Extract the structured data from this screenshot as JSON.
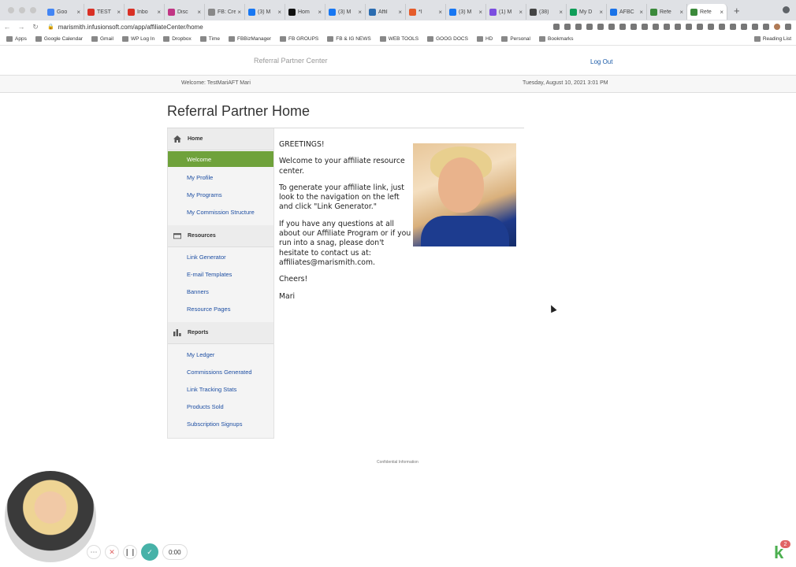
{
  "browser": {
    "tabs": [
      {
        "label": "Goo",
        "color": "#4285f4"
      },
      {
        "label": "TEST",
        "color": "#d93025"
      },
      {
        "label": "Inbo",
        "color": "#d93025"
      },
      {
        "label": "Disc",
        "color": "#c13584"
      },
      {
        "label": "FB: Crea",
        "color": "#888888"
      },
      {
        "label": "(3) M",
        "color": "#1877f2"
      },
      {
        "label": "Hom",
        "color": "#111111"
      },
      {
        "label": "(3) M",
        "color": "#1877f2"
      },
      {
        "label": "Affil",
        "color": "#2b6cb0"
      },
      {
        "label": "*I",
        "color": "#e55c2b"
      },
      {
        "label": "(3) M",
        "color": "#1877f2"
      },
      {
        "label": "(1) M",
        "color": "#7b4de0"
      },
      {
        "label": "(38)",
        "color": "#444444"
      },
      {
        "label": "My D",
        "color": "#0f9d58"
      },
      {
        "label": "AFBC",
        "color": "#1a73e8"
      },
      {
        "label": "Refe",
        "color": "#3b8a3b"
      },
      {
        "label": "Refe",
        "color": "#3b8a3b",
        "active": true
      }
    ],
    "url": "marismith.infusionsoft.com/app/affiliateCenter/home",
    "bookmarks": [
      "Apps",
      "Google Calendar",
      "Gmail",
      "WP Log In",
      "Dropbox",
      "Time",
      "FBBizManager",
      "FB GROUPS",
      "FB & IG NEWS",
      "WEB TOOLS",
      "GOOG DOCS",
      "HD",
      "Personal",
      "Bookmarks"
    ],
    "reading_list": "Reading List"
  },
  "header": {
    "title": "Referral Partner Center",
    "logout": "Log Out",
    "welcome": "Welcome: TestMariAFT Mari",
    "datetime": "Tuesday, August 10, 2021 3:01 PM"
  },
  "page": {
    "heading": "Referral Partner Home"
  },
  "sidebar": {
    "home": {
      "title": "Home",
      "items": [
        "Welcome",
        "My Profile",
        "My Programs",
        "My Commission Structure"
      ]
    },
    "resources": {
      "title": "Resources",
      "items": [
        "Link Generator",
        "E-mail Templates",
        "Banners",
        "Resource Pages"
      ]
    },
    "reports": {
      "title": "Reports",
      "items": [
        "My Ledger",
        "Commissions Generated",
        "Link Tracking Stats",
        "Products Sold",
        "Subscription Signups"
      ]
    }
  },
  "content": {
    "greeting": "GREETINGS!",
    "p1": "Welcome to your affiliate resource center.",
    "p2": "To generate your affiliate link, just look to the navigation on the left and click \"Link Generator.\"",
    "p3": "If you have any questions at all about our Affiliate Program or if you run into a snag, please don't hesitate to contact us at: affiliates@marismith.com.",
    "p4": "Cheers!",
    "p5": "Mari"
  },
  "footer": {
    "text": "Confidential Information"
  },
  "recorder": {
    "timer": "0:00",
    "badge": "2"
  },
  "colors": {
    "active_nav": "#6fa23b",
    "link": "#1e4fa3",
    "record_check": "#47b2a8"
  }
}
